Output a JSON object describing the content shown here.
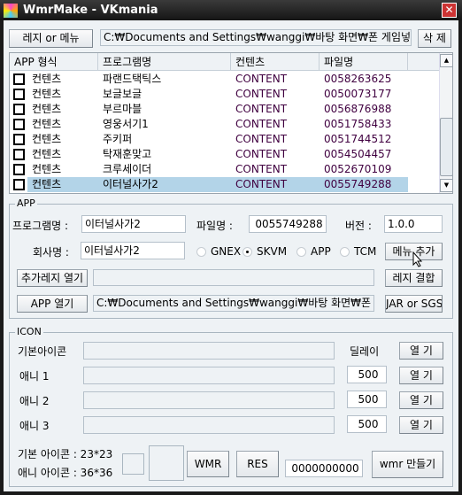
{
  "window": {
    "title": "WmrMake -  VKmania",
    "close": "✕"
  },
  "top": {
    "reg_menu_button": "레지 or 메뉴",
    "path": "C:₩Documents and Settings₩wanggi₩바탕 화면₩폰 게임넣기₩",
    "delete_button": "삭 제"
  },
  "list": {
    "columns": [
      "APP 형식",
      "프로그램명",
      "컨텐츠",
      "파일명"
    ],
    "rows": [
      {
        "type": "컨텐츠",
        "name": "파랜드택틱스",
        "content": "CONTENT",
        "file": "0058263625",
        "checked": false,
        "selected": false
      },
      {
        "type": "컨텐츠",
        "name": "보글보글",
        "content": "CONTENT",
        "file": "0050073177",
        "checked": false,
        "selected": false
      },
      {
        "type": "컨텐츠",
        "name": "부르마블",
        "content": "CONTENT",
        "file": "0056876988",
        "checked": false,
        "selected": false
      },
      {
        "type": "컨텐츠",
        "name": "영웅서기1",
        "content": "CONTENT",
        "file": "0051758433",
        "checked": false,
        "selected": false
      },
      {
        "type": "컨텐츠",
        "name": "주키퍼",
        "content": "CONTENT",
        "file": "0051744512",
        "checked": false,
        "selected": false
      },
      {
        "type": "컨텐츠",
        "name": "탁재훈맞고",
        "content": "CONTENT",
        "file": "0054504457",
        "checked": false,
        "selected": false
      },
      {
        "type": "컨텐츠",
        "name": "크루세이더",
        "content": "CONTENT",
        "file": "0052670109",
        "checked": false,
        "selected": false
      },
      {
        "type": "컨텐츠",
        "name": "이터널사가2",
        "content": "CONTENT",
        "file": "0055749288",
        "checked": false,
        "selected": true
      }
    ]
  },
  "app": {
    "group_label": "APP",
    "program_label": "프로그램명 :",
    "program_value": "이터널사가2",
    "file_label": "파일명 :",
    "file_value": "0055749288",
    "version_label": "버전 :",
    "version_value": "1.0.0",
    "company_label": "회사명 :",
    "company_value": "이터널사가2",
    "radios": [
      {
        "label": "GNEX",
        "checked": false
      },
      {
        "label": "SKVM",
        "checked": true
      },
      {
        "label": "APP",
        "checked": false
      },
      {
        "label": "TCM",
        "checked": false
      }
    ],
    "menu_add_button": "메뉴 추가",
    "open_extra_reg_button": "추가레지 열기",
    "extra_reg_path": "",
    "reg_combine_button": "레지 결합",
    "open_app_button": "APP 열기",
    "app_path": "C:₩Documents and Settings₩wanggi₩바탕 화면₩폰 게임",
    "jar_sgs_button": "JAR or SGS"
  },
  "icon": {
    "group_label": "ICON",
    "delay_label": "딜레이",
    "open_button": "열 기",
    "rows": [
      {
        "label": "기본아이콘",
        "path": "",
        "delay": null
      },
      {
        "label": "애니 1",
        "path": "",
        "delay": "500"
      },
      {
        "label": "애니 2",
        "path": "",
        "delay": "500"
      },
      {
        "label": "애니 3",
        "path": "",
        "delay": "500"
      }
    ],
    "basic_size": "기본 아이콘 : 23*23",
    "ani_size": "애니 아이콘 : 36*36",
    "wmr_button": "WMR",
    "res_button": "RES",
    "code_value": "0000000000",
    "make_button": "wmr 만들기"
  }
}
